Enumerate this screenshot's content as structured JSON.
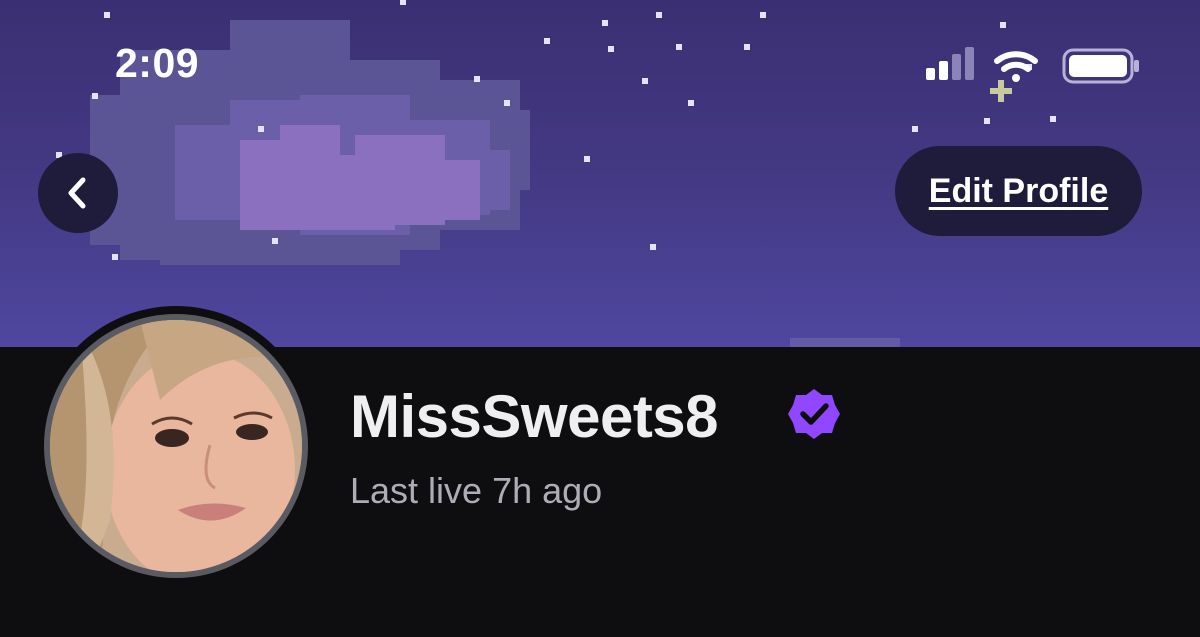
{
  "status_bar": {
    "time": "2:09",
    "icons": [
      "cellular-signal-icon",
      "wifi-icon",
      "battery-icon"
    ]
  },
  "header": {
    "back_icon": "chevron-left-icon",
    "edit_profile_label": "Edit Profile"
  },
  "profile": {
    "username": "MissSweets8",
    "verified_icon": "verified-badge-icon",
    "last_live": "Last live 7h ago"
  },
  "colors": {
    "banner_top": "#3b2f73",
    "banner_bottom": "#4f47a0",
    "background": "#0e0e10",
    "accent": "#9147ff",
    "button_bg": "#1f1b3a",
    "name_text": "#efeff1",
    "subtitle_text": "#adadb8"
  }
}
